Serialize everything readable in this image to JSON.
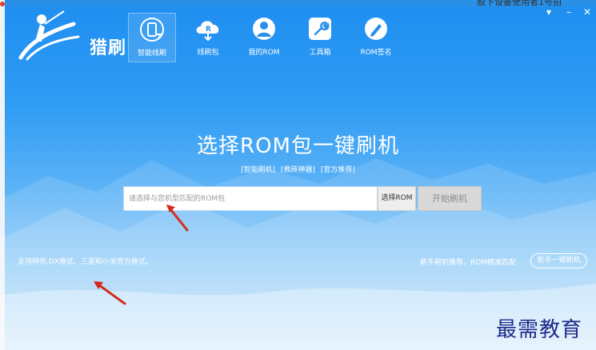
{
  "app": {
    "name": "猎刷"
  },
  "background_peek": {
    "right_text": "股下设备使用者1号拍"
  },
  "nav": {
    "items": [
      {
        "label": "智能线刷",
        "icon": "phone-refresh-icon",
        "active": true
      },
      {
        "label": "线刷包",
        "icon": "cloud-rom-icon",
        "active": false
      },
      {
        "label": "我的ROM",
        "icon": "user-icon",
        "active": false
      },
      {
        "label": "工具箱",
        "icon": "wrench-icon",
        "active": false
      },
      {
        "label": "ROM签名",
        "icon": "pen-icon",
        "active": false
      }
    ]
  },
  "window_controls": {
    "menu": "▾",
    "minimize": "–",
    "close": "✕"
  },
  "main": {
    "headline": "选择ROM包一键刷机",
    "tags": [
      "[智能刷机]",
      "[救砖神器]",
      "[官方推荐]"
    ],
    "search": {
      "placeholder": "请选择与您机型匹配的ROM包",
      "value": "",
      "select_label": "选择ROM",
      "start_label": "开始刷机"
    }
  },
  "footer": {
    "support_text": "支持特供,DX格式、三星和小米官方格式。",
    "newbie_text": "新手刷机推荐，ROM精准匹配",
    "newbie_button": "新手一键刷机"
  },
  "watermark": "最需教育",
  "colors": {
    "accent": "#1e8ef0",
    "arrow": "#d62a1e",
    "watermark": "#1c2a8a",
    "start_button": "#d9d9d9"
  }
}
